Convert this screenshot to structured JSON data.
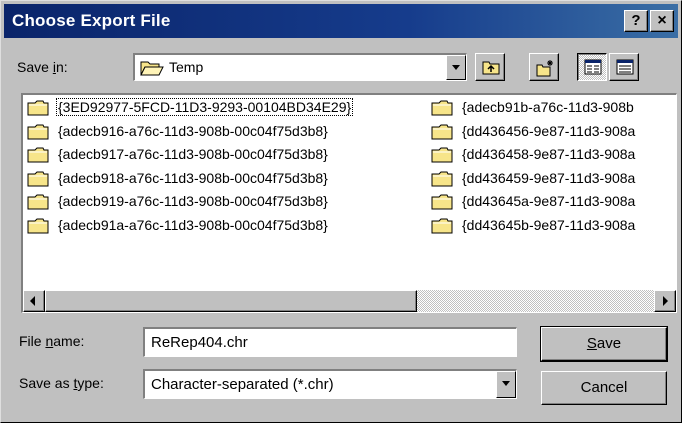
{
  "window": {
    "title": "Choose Export File"
  },
  "title_buttons": {
    "help": "?",
    "close": "×"
  },
  "save_in": {
    "label_pre": "Save ",
    "label_key": "i",
    "label_post": "n:",
    "value": "Temp",
    "icon": "folder-open-icon"
  },
  "toolbar": {
    "icons": [
      "up-one-level-icon",
      "create-new-folder-icon",
      "list-view-icon",
      "details-view-icon"
    ]
  },
  "files": {
    "column1": [
      "{3ED92977-5FCD-11D3-9293-00104BD34E29}",
      "{adecb916-a76c-11d3-908b-00c04f75d3b8}",
      "{adecb917-a76c-11d3-908b-00c04f75d3b8}",
      "{adecb918-a76c-11d3-908b-00c04f75d3b8}",
      "{adecb919-a76c-11d3-908b-00c04f75d3b8}",
      "{adecb91a-a76c-11d3-908b-00c04f75d3b8}"
    ],
    "column2": [
      "{adecb91b-a76c-11d3-908b",
      "{dd436456-9e87-11d3-908a",
      "{dd436458-9e87-11d3-908a",
      "{dd436459-9e87-11d3-908a",
      "{dd43645a-9e87-11d3-908a",
      "{dd43645b-9e87-11d3-908a"
    ],
    "focused_index": 0
  },
  "file_name": {
    "label_pre": "File ",
    "label_key": "n",
    "label_post": "ame:",
    "value": "ReRep404.chr"
  },
  "save_as_type": {
    "label_pre": "Save as ",
    "label_key": "t",
    "label_post": "ype:",
    "value": "Character-separated (*.chr)"
  },
  "buttons": {
    "save_key": "S",
    "save_rest": "ave",
    "cancel": "Cancel"
  },
  "colors": {
    "title_bar": "#0a246a",
    "face": "#c0c0c0",
    "folder": "#f7e58a"
  }
}
